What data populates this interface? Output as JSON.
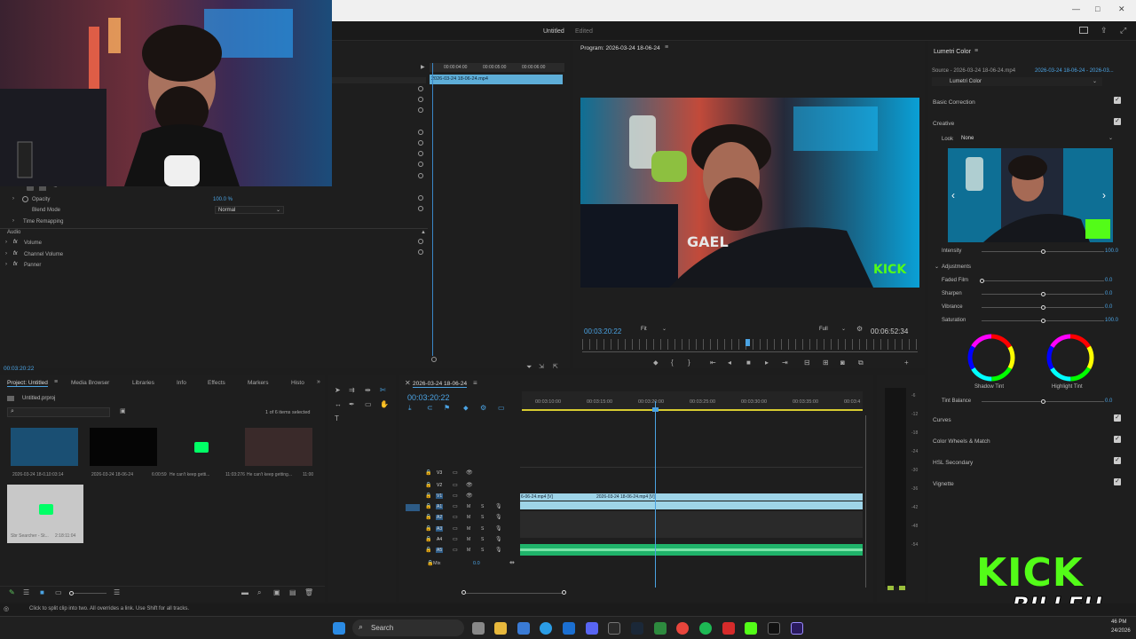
{
  "app": {
    "title": "Untitled",
    "edited": "Edited"
  },
  "effect_controls": {
    "timecode": "00:00:04:00",
    "timecode2": "00:00:05:00",
    "timecode3": "00:00:06:00",
    "clip_name": "2026-03-24 18-06-24.mp4",
    "opacity_label": "Opacity",
    "opacity_value": "100.0 %",
    "blend_label": "Blend Mode",
    "blend_value": "Normal",
    "time_remap": "Time Remapping",
    "audio_header": "Audio",
    "volume": "Volume",
    "channel_volume": "Channel Volume",
    "panner": "Panner",
    "current_time": "00:03:20:22"
  },
  "program": {
    "title": "Program: 2026-03-24 18-06-24",
    "timecode": "00:03:20:22",
    "fit": "Fit",
    "quality": "Full",
    "duration": "00:06:52:34"
  },
  "project": {
    "tabs": [
      "Project: Untitled",
      "Media Browser",
      "Libraries",
      "Info",
      "Effects",
      "Markers",
      "Histo"
    ],
    "file": "Untitled.prproj",
    "selected": "1 of 6 items selected",
    "items": [
      {
        "name": "2026-03-24 18-0...",
        "dur": "10:03:14"
      },
      {
        "name": "2026-03-24 18-06-24",
        "dur": "6:00:59"
      },
      {
        "name": "He can't keep getti...",
        "dur": "11:03:276"
      },
      {
        "name": "He can't keep getting...",
        "dur": "11:00"
      },
      {
        "name": "Sbr Searcher - St...",
        "dur": "2:18:11:04"
      }
    ]
  },
  "timeline": {
    "sequence": "2026-03-24 18-06-24",
    "timecode": "00:03:20:22",
    "ruler": [
      "00:03:10:00",
      "00:03:15:00",
      "00:03:20:00",
      "00:03:25:00",
      "00:03:30:00",
      "00:03:35:00",
      "00:03:4"
    ],
    "tracks": [
      "V3",
      "V2",
      "V1",
      "A1",
      "A2",
      "A3",
      "A4",
      "A5"
    ],
    "mix_label": "Mix",
    "mix_value": "0.0",
    "clip_a": "6-06-24.mp4 [V]",
    "clip_b": "2026-03-24 18-06-24.mp4 [V]",
    "meter_labels": [
      "-6",
      "-12",
      "-18",
      "-24",
      "-30",
      "-36",
      "-42",
      "-48",
      "-54"
    ]
  },
  "lumetri": {
    "title": "Lumetri Color",
    "source": "Source - 2026-03-24 18-06-24.mp4",
    "source_link": "2026-03-24 18-06-24 - 2026-03...",
    "preset": "Lumetri Color",
    "basic": "Basic Correction",
    "creative": "Creative",
    "look_label": "Look",
    "look_value": "None",
    "intensity_label": "Intensity",
    "intensity_value": "100.0",
    "adjustments": "Adjustments",
    "sliders": [
      {
        "label": "Faded Film",
        "value": "0.0"
      },
      {
        "label": "Sharpen",
        "value": "0.0"
      },
      {
        "label": "Vibrance",
        "value": "0.0"
      },
      {
        "label": "Saturation",
        "value": "100.0"
      }
    ],
    "shadow_tint": "Shadow Tint",
    "highlight_tint": "Highlight Tint",
    "tint_balance_label": "Tint Balance",
    "tint_balance_value": "0.0",
    "sections": [
      "Curves",
      "Color Wheels & Match",
      "HSL Secondary",
      "Vignette"
    ]
  },
  "status": "Click to split clip into two. All overrides a link. Use Shift for all tracks.",
  "overlay": {
    "kick": "KICK",
    "name": "BILLEH"
  },
  "taskbar": {
    "search": "Search",
    "time": "46 PM",
    "date": "24/2026"
  }
}
